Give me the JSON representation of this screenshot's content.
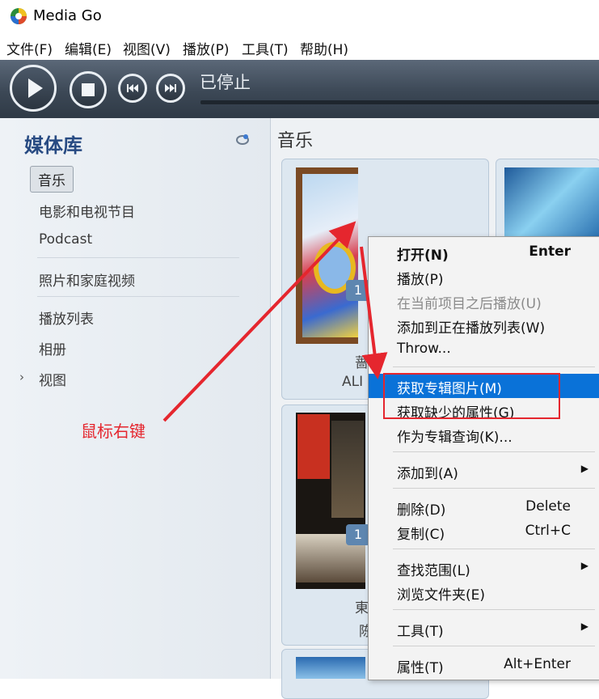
{
  "window": {
    "title": "Media Go"
  },
  "menubar": [
    "文件(F)",
    "编辑(E)",
    "视图(V)",
    "播放(P)",
    "工具(T)",
    "帮助(H)"
  ],
  "transport": {
    "status": "已停止"
  },
  "sidebar": {
    "title": "媒体库",
    "items": [
      "音乐",
      "电影和电视节目",
      "Podcast",
      "照片和家庭视频",
      "播放列表",
      "相册",
      "视图"
    ]
  },
  "content": {
    "title": "音乐",
    "tiles": [
      {
        "badge": "1",
        "title": "蔷",
        "artist": "ALI"
      },
      {
        "badge": "1",
        "title": "東",
        "artist": "陈"
      }
    ]
  },
  "context_menu": {
    "items": [
      {
        "label": "打开(N)",
        "shortcut": "Enter"
      },
      {
        "label": "播放(P)"
      },
      {
        "label": "在当前项目之后播放(U)"
      },
      {
        "label": "添加到正在播放列表(W)"
      },
      {
        "label": "Throw..."
      },
      {
        "label": "获取专辑图片(M)"
      },
      {
        "label": "获取缺少的属性(G)"
      },
      {
        "label": "作为专辑查询(K)..."
      },
      {
        "label": "添加到(A)"
      },
      {
        "label": "删除(D)",
        "shortcut": "Delete"
      },
      {
        "label": "复制(C)",
        "shortcut": "Ctrl+C"
      },
      {
        "label": "查找范围(L)"
      },
      {
        "label": "浏览文件夹(E)"
      },
      {
        "label": "工具(T)"
      },
      {
        "label": "属性(T)",
        "shortcut": "Alt+Enter"
      }
    ]
  },
  "annotation": {
    "text": "鼠标右键"
  },
  "colors": {
    "highlight": "#0a72d8",
    "annotation_red": "#e5262e",
    "transport_bg": "#3c4856",
    "library_title": "#274a82"
  }
}
